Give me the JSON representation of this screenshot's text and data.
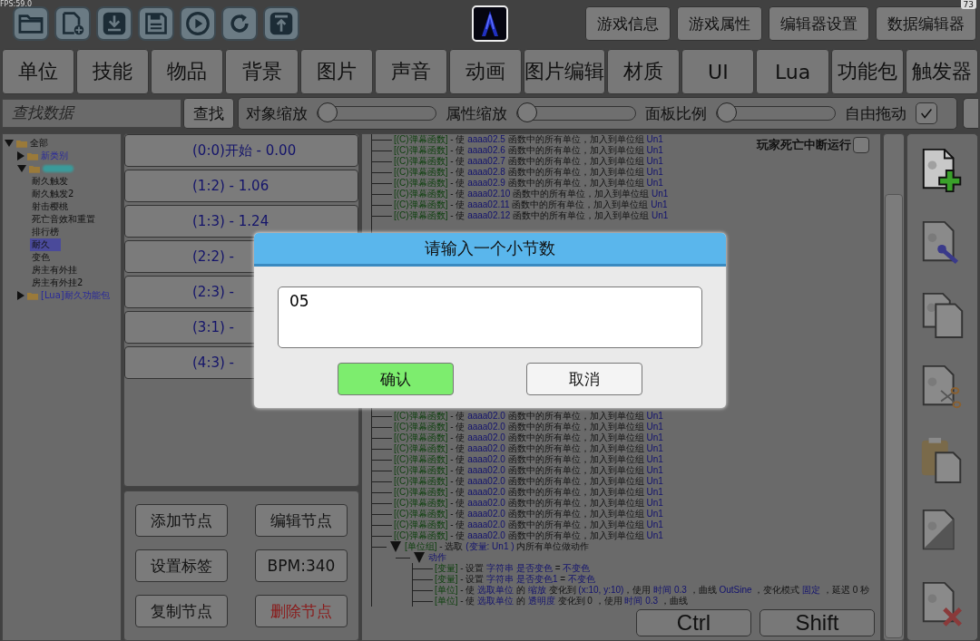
{
  "fps": "FPS:59.0",
  "corner_badge": "73",
  "top_buttons": [
    "游戏信息",
    "游戏属性",
    "编辑器设置",
    "数据编辑器"
  ],
  "tabs": [
    "单位",
    "技能",
    "物品",
    "背景",
    "图片",
    "声音",
    "动画",
    "图片编辑",
    "材质",
    "UI",
    "Lua",
    "功能包",
    "触发器"
  ],
  "search": {
    "placeholder": "查找数据",
    "button": "查找"
  },
  "sliders": [
    {
      "label": "对象缩放",
      "level": 0
    },
    {
      "label": "属性缩放",
      "level": 0
    },
    {
      "label": "面板比例",
      "level": 0
    }
  ],
  "free_drag": {
    "label": "自由拖动",
    "checked": true
  },
  "tree": [
    {
      "label": "全部",
      "expanded": true,
      "children": [
        {
          "kind": "folder",
          "label": "新类别",
          "color": "#2a2a9a",
          "expanded": false
        },
        {
          "kind": "blurred",
          "color": "#3a9a9a",
          "expanded": true,
          "children": [
            {
              "label": "耐久触发",
              "selected": false
            },
            {
              "label": "耐久触发2",
              "selected": false
            },
            {
              "label": "射击樱桃",
              "selected": false
            },
            {
              "label": "死亡音效和重置",
              "selected": false
            },
            {
              "label": "排行榜",
              "selected": false
            },
            {
              "label": "耐久",
              "selected": true
            },
            {
              "label": "变色",
              "selected": false
            },
            {
              "label": "房主有外挂",
              "selected": false
            },
            {
              "label": "房主有外挂2",
              "selected": false
            }
          ]
        },
        {
          "kind": "folder",
          "label": "[Lua]耐久功能包",
          "color": "#2a2a9a",
          "expanded": false
        }
      ]
    }
  ],
  "nodes": [
    "(0:0)开始 - 0.00",
    "(1:2) - 1.06",
    "(1:3) - 1.24",
    "(2:2) -",
    "(2:3) -",
    "(3:1) -",
    "(4:3) -"
  ],
  "node_actions": [
    {
      "label": "添加节点",
      "kind": "normal"
    },
    {
      "label": "编辑节点",
      "kind": "normal"
    },
    {
      "label": "设置标签",
      "kind": "normal"
    },
    {
      "label": "BPM:340",
      "kind": "normal"
    },
    {
      "label": "复制节点",
      "kind": "normal"
    },
    {
      "label": "删除节点",
      "kind": "danger"
    }
  ],
  "trigger": {
    "stop_on_death": {
      "label": "玩家死亡中断运行",
      "checked": false
    },
    "lines_top": [
      [
        {
          "t": "[(C)弹幕函数]",
          "kind": "category"
        },
        {
          "t": " - 使 ",
          "kind": "plain"
        },
        {
          "t": "aaaa02.5",
          "kind": "ref"
        },
        {
          "t": " 函数中的所有单位，加入到单位组 ",
          "kind": "plain"
        },
        {
          "t": "Un1",
          "kind": "ref"
        }
      ],
      [
        {
          "t": "[(C)弹幕函数]",
          "kind": "category"
        },
        {
          "t": " - 使 ",
          "kind": "plain"
        },
        {
          "t": "aaaa02.6",
          "kind": "ref"
        },
        {
          "t": " 函数中的所有单位，加入到单位组 ",
          "kind": "plain"
        },
        {
          "t": "Un1",
          "kind": "ref"
        }
      ],
      [
        {
          "t": "[(C)弹幕函数]",
          "kind": "category"
        },
        {
          "t": " - 使 ",
          "kind": "plain"
        },
        {
          "t": "aaaa02.7",
          "kind": "ref"
        },
        {
          "t": " 函数中的所有单位，加入到单位组 ",
          "kind": "plain"
        },
        {
          "t": "Un1",
          "kind": "ref"
        }
      ],
      [
        {
          "t": "[(C)弹幕函数]",
          "kind": "category"
        },
        {
          "t": " - 使 ",
          "kind": "plain"
        },
        {
          "t": "aaaa02.8",
          "kind": "ref"
        },
        {
          "t": " 函数中的所有单位，加入到单位组 ",
          "kind": "plain"
        },
        {
          "t": "Un1",
          "kind": "ref"
        }
      ],
      [
        {
          "t": "[(C)弹幕函数]",
          "kind": "category"
        },
        {
          "t": " - 使 ",
          "kind": "plain"
        },
        {
          "t": "aaaa02.9",
          "kind": "ref"
        },
        {
          "t": " 函数中的所有单位，加入到单位组 ",
          "kind": "plain"
        },
        {
          "t": "Un1",
          "kind": "ref"
        }
      ],
      [
        {
          "t": "[(C)弹幕函数]",
          "kind": "category"
        },
        {
          "t": " - 使 ",
          "kind": "plain"
        },
        {
          "t": "aaaa02.10",
          "kind": "ref"
        },
        {
          "t": " 函数中的所有单位，加入到单位组 ",
          "kind": "plain"
        },
        {
          "t": "Un1",
          "kind": "ref"
        }
      ],
      [
        {
          "t": "[(C)弹幕函数]",
          "kind": "category"
        },
        {
          "t": " - 使 ",
          "kind": "plain"
        },
        {
          "t": "aaaa02.11",
          "kind": "ref"
        },
        {
          "t": " 函数中的所有单位，加入到单位组 ",
          "kind": "plain"
        },
        {
          "t": "Un1",
          "kind": "ref"
        }
      ],
      [
        {
          "t": "[(C)弹幕函数]",
          "kind": "category"
        },
        {
          "t": " - 使 ",
          "kind": "plain"
        },
        {
          "t": "aaaa02.12",
          "kind": "ref"
        },
        {
          "t": " 函数中的所有单位，加入到单位组 ",
          "kind": "plain"
        },
        {
          "t": "Un1",
          "kind": "ref"
        }
      ]
    ],
    "lines_bottom": [
      [
        {
          "t": "[(C)弹幕函数]",
          "kind": "category"
        },
        {
          "t": " - 使 ",
          "kind": "plain"
        },
        {
          "t": "aaaa02.0",
          "kind": "ref"
        },
        {
          "t": " 函数中的所有单位，加入到单位组 ",
          "kind": "plain"
        },
        {
          "t": "Un1",
          "kind": "ref"
        }
      ],
      [
        {
          "t": "[(C)弹幕函数]",
          "kind": "category"
        },
        {
          "t": " - 使 ",
          "kind": "plain"
        },
        {
          "t": "aaaa02.0",
          "kind": "ref"
        },
        {
          "t": " 函数中的所有单位，加入到单位组 ",
          "kind": "plain"
        },
        {
          "t": "Un1",
          "kind": "ref"
        }
      ],
      [
        {
          "t": "[(C)弹幕函数]",
          "kind": "category"
        },
        {
          "t": " - 使 ",
          "kind": "plain"
        },
        {
          "t": "aaaa02.0",
          "kind": "ref"
        },
        {
          "t": " 函数中的所有单位，加入到单位组 ",
          "kind": "plain"
        },
        {
          "t": "Un1",
          "kind": "ref"
        }
      ],
      [
        {
          "t": "[(C)弹幕函数]",
          "kind": "category"
        },
        {
          "t": " - 使 ",
          "kind": "plain"
        },
        {
          "t": "aaaa02.0",
          "kind": "ref"
        },
        {
          "t": " 函数中的所有单位，加入到单位组 ",
          "kind": "plain"
        },
        {
          "t": "Un1",
          "kind": "ref"
        }
      ],
      [
        {
          "t": "[(C)弹幕函数]",
          "kind": "category"
        },
        {
          "t": " - 使 ",
          "kind": "plain"
        },
        {
          "t": "aaaa02.0",
          "kind": "ref"
        },
        {
          "t": " 函数中的所有单位，加入到单位组 ",
          "kind": "plain"
        },
        {
          "t": "Un1",
          "kind": "ref"
        }
      ],
      [
        {
          "t": "[(C)弹幕函数]",
          "kind": "category"
        },
        {
          "t": " - 使 ",
          "kind": "plain"
        },
        {
          "t": "aaaa02.0",
          "kind": "ref"
        },
        {
          "t": " 函数中的所有单位，加入到单位组 ",
          "kind": "plain"
        },
        {
          "t": "Un1",
          "kind": "ref"
        }
      ],
      [
        {
          "t": "[(C)弹幕函数]",
          "kind": "category"
        },
        {
          "t": " - 使 ",
          "kind": "plain"
        },
        {
          "t": "aaaa02.0",
          "kind": "ref"
        },
        {
          "t": " 函数中的所有单位，加入到单位组 ",
          "kind": "plain"
        },
        {
          "t": "Un1",
          "kind": "ref"
        }
      ],
      [
        {
          "t": "[(C)弹幕函数]",
          "kind": "category"
        },
        {
          "t": " - 使 ",
          "kind": "plain"
        },
        {
          "t": "aaaa02.0",
          "kind": "ref"
        },
        {
          "t": " 函数中的所有单位，加入到单位组 ",
          "kind": "plain"
        },
        {
          "t": "Un1",
          "kind": "ref"
        }
      ],
      [
        {
          "t": "[(C)弹幕函数]",
          "kind": "category"
        },
        {
          "t": " - 使 ",
          "kind": "plain"
        },
        {
          "t": "aaaa02.0",
          "kind": "ref"
        },
        {
          "t": " 函数中的所有单位，加入到单位组 ",
          "kind": "plain"
        },
        {
          "t": "Un1",
          "kind": "ref"
        }
      ],
      [
        {
          "t": "[(C)弹幕函数]",
          "kind": "category"
        },
        {
          "t": " - 使 ",
          "kind": "plain"
        },
        {
          "t": "aaaa02.0",
          "kind": "ref"
        },
        {
          "t": " 函数中的所有单位，加入到单位组 ",
          "kind": "plain"
        },
        {
          "t": "Un1",
          "kind": "ref"
        }
      ],
      [
        {
          "t": "[(C)弹幕函数]",
          "kind": "category"
        },
        {
          "t": " - 使 ",
          "kind": "plain"
        },
        {
          "t": "aaaa02.0",
          "kind": "ref"
        },
        {
          "t": " 函数中的所有单位，加入到单位组 ",
          "kind": "plain"
        },
        {
          "t": "Un1",
          "kind": "ref"
        }
      ],
      [
        {
          "t": "[(C)弹幕函数]",
          "kind": "category"
        },
        {
          "t": " - 使 ",
          "kind": "plain"
        },
        {
          "t": "aaaa02.0",
          "kind": "ref"
        },
        {
          "t": " 函数中的所有单位，加入到单位组 ",
          "kind": "plain"
        },
        {
          "t": "Un1",
          "kind": "ref"
        }
      ]
    ],
    "group": {
      "expanded": true,
      "segments": [
        {
          "t": "[单位组]",
          "kind": "category"
        },
        {
          "t": " - 选取 ",
          "kind": "plain"
        },
        {
          "t": "(变量: Un1 )",
          "kind": "ref"
        },
        {
          "t": " 内所有单位做动作",
          "kind": "plain"
        }
      ],
      "block": {
        "expanded": true,
        "segments": [
          {
            "t": "动作",
            "kind": "ref"
          }
        ],
        "actions": [
          [
            {
              "t": "[变量]",
              "kind": "category"
            },
            {
              "t": " - 设置 ",
              "kind": "plain"
            },
            {
              "t": "字符串 ",
              "kind": "ref"
            },
            {
              "t": "是否变色",
              "kind": "ref"
            },
            {
              "t": " = ",
              "kind": "plain"
            },
            {
              "t": "不变色",
              "kind": "ref"
            }
          ],
          [
            {
              "t": "[变量]",
              "kind": "category"
            },
            {
              "t": " - 设置 ",
              "kind": "plain"
            },
            {
              "t": "字符串 ",
              "kind": "ref"
            },
            {
              "t": "是否变色1",
              "kind": "ref"
            },
            {
              "t": " = ",
              "kind": "plain"
            },
            {
              "t": "不变色",
              "kind": "ref"
            }
          ],
          [
            {
              "t": "[单位]",
              "kind": "category"
            },
            {
              "t": " - 使 ",
              "kind": "plain"
            },
            {
              "t": "选取单位",
              "kind": "ref"
            },
            {
              "t": " 的 ",
              "kind": "plain"
            },
            {
              "t": "缩放",
              "kind": "ref"
            },
            {
              "t": " 变化到 ",
              "kind": "plain"
            },
            {
              "t": "(x:10, y:10)",
              "kind": "ref"
            },
            {
              "t": "，使用 ",
              "kind": "plain"
            },
            {
              "t": "时间 ",
              "kind": "ref"
            },
            {
              "t": "0.3",
              "kind": "ref"
            },
            {
              "t": " ，曲线 ",
              "kind": "plain"
            },
            {
              "t": "OutSine",
              "kind": "ref"
            },
            {
              "t": " ，变化模式 ",
              "kind": "plain"
            },
            {
              "t": "固定",
              "kind": "ref"
            },
            {
              "t": " ，延迟 0 秒",
              "kind": "plain"
            }
          ],
          [
            {
              "t": "[单位]",
              "kind": "category"
            },
            {
              "t": " - 使 ",
              "kind": "plain"
            },
            {
              "t": "选取单位",
              "kind": "ref"
            },
            {
              "t": " 的 ",
              "kind": "plain"
            },
            {
              "t": "透明度",
              "kind": "ref"
            },
            {
              "t": " 变化到 0 ，使用 ",
              "kind": "plain"
            },
            {
              "t": "时间 ",
              "kind": "ref"
            },
            {
              "t": "0.3",
              "kind": "ref"
            },
            {
              "t": " ，曲线",
              "kind": "plain"
            }
          ]
        ]
      }
    }
  },
  "shortcut_keys": [
    "Ctrl",
    "Shift"
  ],
  "dialog": {
    "title": "请输入一个小节数",
    "value": "05",
    "buttons": [
      {
        "label": "确认",
        "kind": "primary"
      },
      {
        "label": "取消",
        "kind": "normal"
      }
    ]
  }
}
